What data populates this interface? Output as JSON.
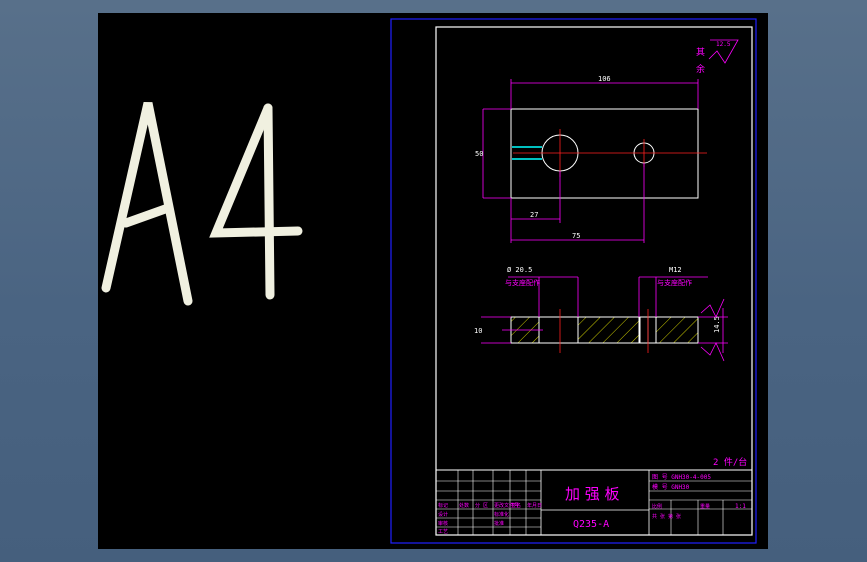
{
  "watermark": {
    "text": "A4"
  },
  "drawing": {
    "roughness_mark": "12.5",
    "roughness_note": [
      "其",
      "余"
    ],
    "dimensions": {
      "overall_width": "106",
      "overall_height": "50",
      "hole1_offset": "27",
      "hole2_offset": "75",
      "hole1_diameter": "Ø 20.5",
      "hole1_note": "与支座配作",
      "thread": "M12",
      "thread_note": "与支座配作",
      "thickness_right": "14.5",
      "thickness_left": "10"
    },
    "quantity_note": "2 件/台"
  },
  "title_block": {
    "part_name": "加 强 板",
    "material": "Q235-A",
    "drawing_no": "图 号  GNH30-4-005",
    "drawing_label2": "模 号  GNH30",
    "scale": "1:1",
    "small_labels": [
      "标记",
      "处数",
      "分 区",
      "更改文件号",
      "签名",
      "年月日",
      "设计",
      "审核",
      "工艺",
      "标准化",
      "批准",
      "比例",
      "重量",
      "共  张  第  张"
    ]
  },
  "colors": {
    "frame": "#2020ff",
    "line": "#ffffff",
    "dimension": "#ff00ff",
    "center": "#ff2020",
    "hidden": "#00ffff",
    "hatch": "#ffff00",
    "watermark": "#f0f0e0"
  }
}
